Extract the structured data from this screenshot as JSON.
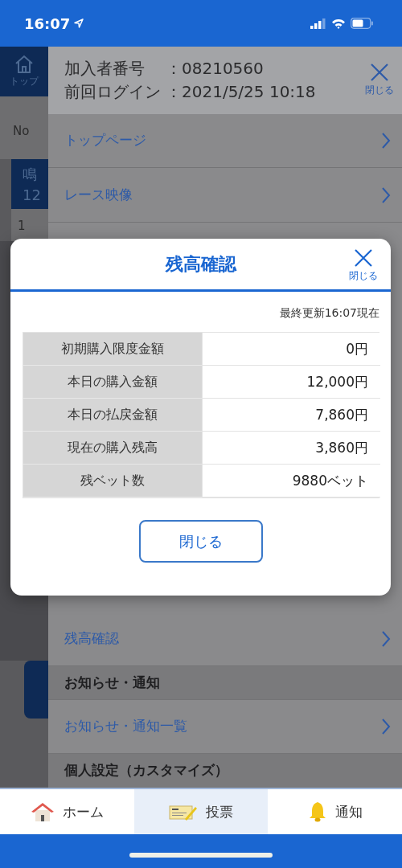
{
  "status_bar": {
    "time": "16:07"
  },
  "background_page": {
    "home_label": "トップ",
    "no_label": "No",
    "venue": "鳴",
    "race": "12",
    "row_number": "1"
  },
  "drawer": {
    "info": [
      {
        "label": "加入者番号",
        "value": "：08210560"
      },
      {
        "label": "前回ログイン",
        "value": "：2021/5/25 10:18"
      }
    ],
    "close_label": "閉じる",
    "menu_top": [
      {
        "kind": "link",
        "label": "トップページ"
      },
      {
        "kind": "link",
        "label": "レース映像"
      }
    ],
    "menu_bottom": [
      {
        "kind": "link",
        "label": "残高確認"
      },
      {
        "kind": "section",
        "label": "お知らせ・通知"
      },
      {
        "kind": "link",
        "label": "お知らせ・通知一覧"
      },
      {
        "kind": "section",
        "label": "個人設定（カスタマイズ）"
      }
    ]
  },
  "modal": {
    "title": "残高確認",
    "close_label": "閉じる",
    "updated": "最終更新16:07現在",
    "rows": [
      {
        "label": "初期購入限度金額",
        "value": "0円"
      },
      {
        "label": "本日の購入金額",
        "value": "12,000円"
      },
      {
        "label": "本日の払戻金額",
        "value": "7,860円"
      },
      {
        "label": "現在の購入残高",
        "value": "3,860円"
      },
      {
        "label": "残ベット数",
        "value": "9880ベット"
      }
    ],
    "button": "閉じる"
  },
  "tab_bar": {
    "tabs": [
      {
        "kind": "home",
        "label": "ホーム",
        "selected": false
      },
      {
        "kind": "ticket",
        "label": "投票",
        "selected": true
      },
      {
        "kind": "bell",
        "label": "通知",
        "selected": false
      }
    ]
  }
}
